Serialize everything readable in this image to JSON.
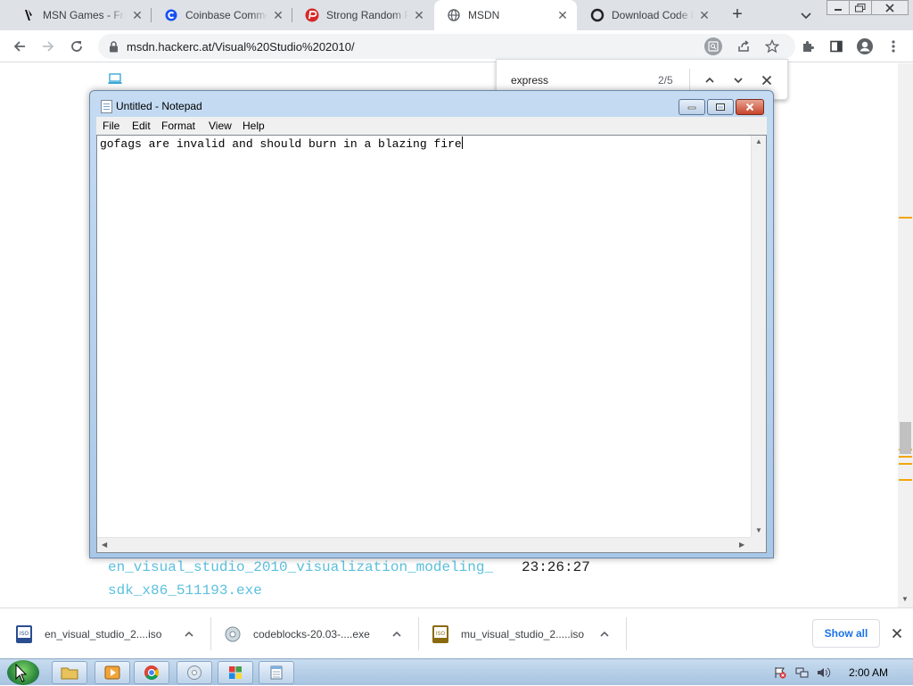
{
  "browser": {
    "tabs": [
      {
        "title": "MSN Games - Free",
        "icon": "msn-games-icon",
        "active": false
      },
      {
        "title": "Coinbase Commerce",
        "icon": "coinbase-icon",
        "active": false
      },
      {
        "title": "Strong Random Passwords",
        "icon": "password-icon",
        "active": false
      },
      {
        "title": "MSDN",
        "icon": "globe-icon",
        "active": true
      },
      {
        "title": "Download Code Blocks",
        "icon": "codeblocks-icon",
        "active": false
      }
    ],
    "new_tab_label": "+",
    "url": "msdn.hackerc.at/Visual%20Studio%202010/"
  },
  "find_bar": {
    "query": "express",
    "count": "2/5"
  },
  "page": {
    "file_name_line1": "en_visual_studio_2010_visualization_modeling_",
    "file_name_line2": "sdk_x86_511193.exe",
    "file_time": "23:26:27"
  },
  "notepad": {
    "title": "Untitled - Notepad",
    "menu": [
      "File",
      "Edit",
      "Format",
      "View",
      "Help"
    ],
    "text": "gofags are invalid and should burn in a blazing fire"
  },
  "downloads": {
    "items": [
      {
        "name": "en_visual_studio_2....iso",
        "icon": "iso-file-icon"
      },
      {
        "name": "codeblocks-20.03-....exe",
        "icon": "installer-icon"
      },
      {
        "name": "mu_visual_studio_2.....iso",
        "icon": "iso-file-icon"
      }
    ],
    "show_all_label": "Show all"
  },
  "taskbar": {
    "clock": "2:00 AM"
  },
  "colors": {
    "link_cyan": "#5bc0de",
    "chrome_blue": "#1a73e8",
    "scroll_marker": "#f2a60c"
  }
}
